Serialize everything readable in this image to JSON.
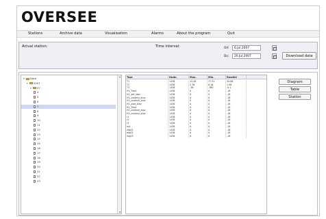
{
  "app": {
    "logo_text": "OVERSEE"
  },
  "menu": [
    {
      "label": "Stations"
    },
    {
      "label": "Archive data"
    },
    {
      "label": "Visualisation"
    },
    {
      "label": "Alarms"
    },
    {
      "label": "About the program"
    },
    {
      "label": "Quit"
    }
  ],
  "controls": {
    "station_label": "Actual station:",
    "interval_label": "Time interval:",
    "from_label": "Od:",
    "to_label": "Do:",
    "from_value": "6.Jul.2007",
    "to_value": "20.Jul.2007",
    "download_label": "Download data"
  },
  "tree": {
    "rows": [
      {
        "type": "folder",
        "label": "Data",
        "level": 0,
        "expanded": true
      },
      {
        "type": "folder",
        "label": "2007",
        "level": 1,
        "expanded": true
      },
      {
        "type": "folder",
        "label": "07",
        "level": 2,
        "expanded": true
      },
      {
        "type": "file",
        "label": "4",
        "level": 3
      },
      {
        "type": "file",
        "label": "5",
        "level": 3
      },
      {
        "type": "file",
        "label": "6",
        "level": 3
      },
      {
        "type": "file",
        "label": "7",
        "level": 3,
        "selected": true
      },
      {
        "type": "file",
        "label": "8",
        "level": 3
      },
      {
        "type": "file",
        "label": "9",
        "level": 3
      },
      {
        "type": "file",
        "label": "10",
        "level": 3
      },
      {
        "type": "file",
        "label": "11",
        "level": 3
      },
      {
        "type": "file",
        "label": "12",
        "level": 3
      },
      {
        "type": "file",
        "label": "13",
        "level": 3
      },
      {
        "type": "file",
        "label": "14",
        "level": 3
      },
      {
        "type": "file",
        "label": "15",
        "level": 3
      },
      {
        "type": "file",
        "label": "16",
        "level": 3
      },
      {
        "type": "file",
        "label": "17",
        "level": 3
      },
      {
        "type": "file",
        "label": "18",
        "level": 3
      },
      {
        "type": "file",
        "label": "19",
        "level": 3
      },
      {
        "type": "file",
        "label": "20",
        "level": 3
      },
      {
        "type": "file",
        "label": "21",
        "level": 3
      },
      {
        "type": "file",
        "label": "22",
        "level": 3
      },
      {
        "type": "file",
        "label": "23",
        "level": 3
      }
    ]
  },
  "table": {
    "columns": [
      "Tepl.",
      "Hodn.",
      "Max.",
      "Min.",
      "Rozdiel"
    ],
    "rows": [
      [
        "T1",
        "1438",
        "15.48",
        "17.91",
        "30.86"
      ],
      [
        "T2",
        "1438",
        "2.76",
        "6.16",
        "1.98"
      ],
      [
        "T3",
        "1438",
        "-36",
        "-360",
        "-0.1"
      ],
      [
        "H1_Time",
        "1438",
        "0",
        "0",
        "-18"
      ],
      [
        "H1_akt_stav",
        "1438",
        "0",
        "0",
        "-18"
      ],
      [
        "H1_zvoleny_stav",
        "1438",
        "0",
        "0",
        "-18"
      ],
      [
        "H1_zvolene_stav",
        "1438",
        "0",
        "0",
        "-18"
      ],
      [
        "H1_ziad_stav",
        "1438",
        "0",
        "0",
        "-18"
      ],
      [
        "H2_Time",
        "1438",
        "0",
        "0",
        "-18"
      ],
      [
        "H2_zvolene_stav",
        "1438",
        "0",
        "0",
        "-18"
      ],
      [
        "H2_zvoleny_stav",
        "1438",
        "0",
        "0",
        "-18"
      ],
      [
        "r1",
        "1438",
        "0",
        "0",
        "-18"
      ],
      [
        "r2",
        "1438",
        "0",
        "0",
        "-18"
      ],
      [
        "r3",
        "1438",
        "0",
        "0",
        "-18"
      ],
      [
        "m4",
        "1438",
        "0",
        "0",
        "-18"
      ],
      [
        "reg01",
        "1438",
        "0",
        "0",
        "-18"
      ],
      [
        "reg02",
        "1438",
        "0",
        "0",
        "-18"
      ],
      [
        "reg03",
        "1438",
        "0",
        "0",
        "-18"
      ]
    ]
  },
  "side_buttons": [
    {
      "label": "Diagram"
    },
    {
      "label": "Table"
    },
    {
      "label": "Station"
    }
  ]
}
